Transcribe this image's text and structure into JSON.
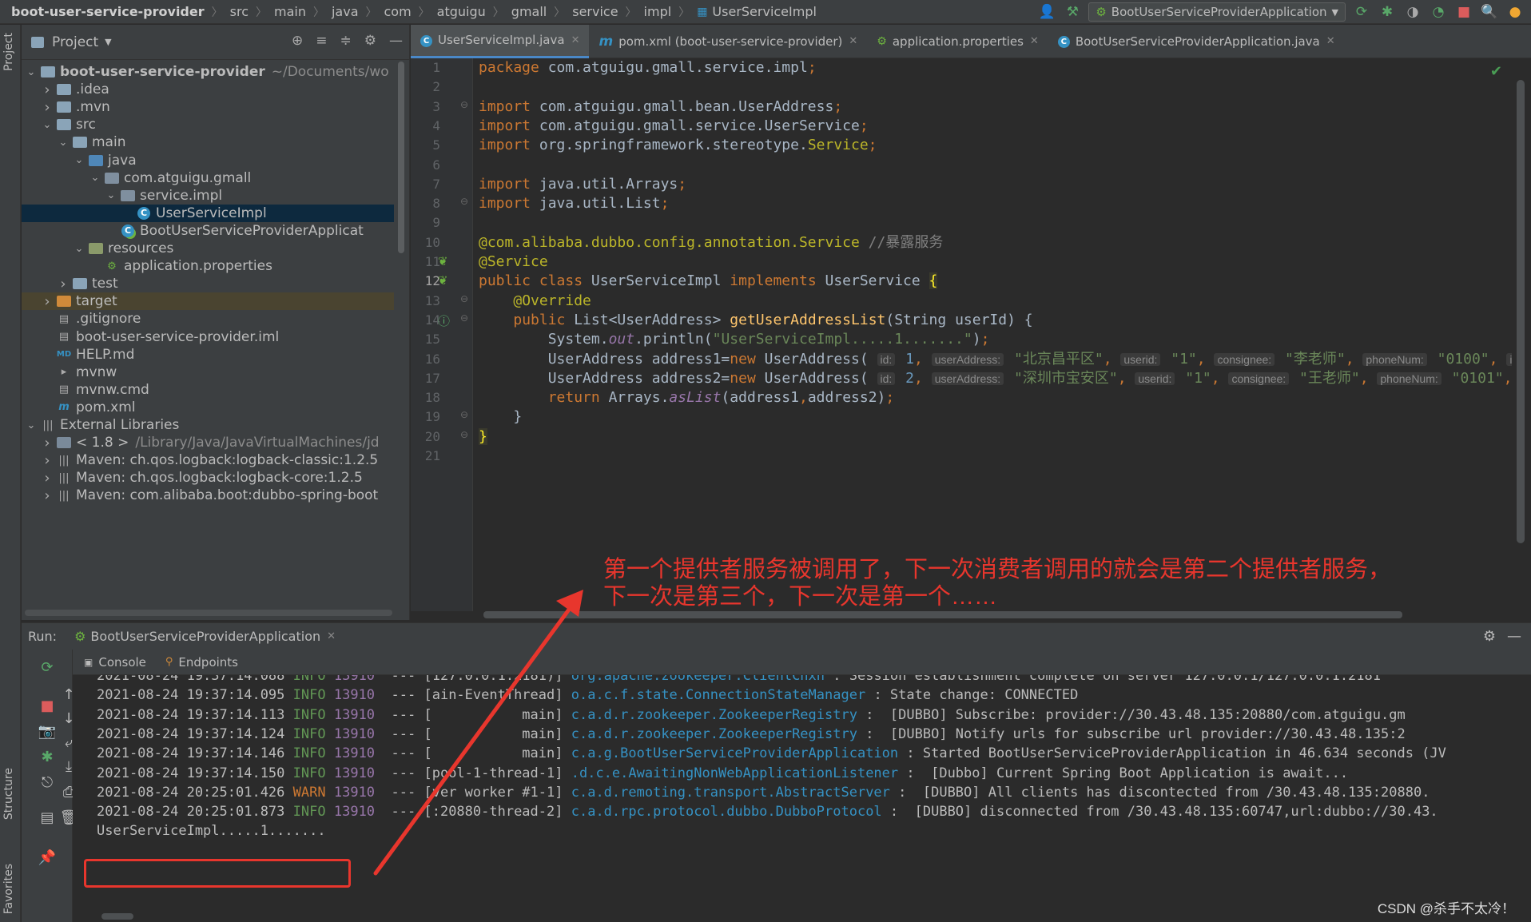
{
  "breadcrumbs": [
    "boot-user-service-provider",
    "src",
    "main",
    "java",
    "com",
    "atguigu",
    "gmall",
    "service",
    "impl",
    "UserServiceImpl"
  ],
  "run_config": "BootUserServiceProviderApplication",
  "left_stripe": {
    "project": "Project",
    "structure": "Structure",
    "favorites": "Favorites"
  },
  "project_panel": {
    "title": "Project",
    "tree": [
      {
        "label": "boot-user-service-provider",
        "extra": "~/Documents/wo",
        "depth": 0,
        "arrow": "down",
        "icon": "module-folder-icon",
        "bold": true
      },
      {
        "label": ".idea",
        "depth": 1,
        "arrow": "right",
        "icon": "folder-icon"
      },
      {
        "label": ".mvn",
        "depth": 1,
        "arrow": "right",
        "icon": "folder-icon"
      },
      {
        "label": "src",
        "depth": 1,
        "arrow": "down",
        "icon": "folder-icon"
      },
      {
        "label": "main",
        "depth": 2,
        "arrow": "down",
        "icon": "folder-icon"
      },
      {
        "label": "java",
        "depth": 3,
        "arrow": "down",
        "icon": "source-folder-icon"
      },
      {
        "label": "com.atguigu.gmall",
        "depth": 4,
        "arrow": "down",
        "icon": "package-icon"
      },
      {
        "label": "service.impl",
        "depth": 5,
        "arrow": "down",
        "icon": "package-icon"
      },
      {
        "label": "UserServiceImpl",
        "depth": 6,
        "arrow": "none",
        "icon": "class-icon",
        "selected": true
      },
      {
        "label": "BootUserServiceProviderApplicat",
        "depth": 5,
        "arrow": "none",
        "icon": "spring-class-icon"
      },
      {
        "label": "resources",
        "depth": 3,
        "arrow": "down",
        "icon": "resources-folder-icon"
      },
      {
        "label": "application.properties",
        "depth": 4,
        "arrow": "none",
        "icon": "properties-file-icon"
      },
      {
        "label": "test",
        "depth": 2,
        "arrow": "right",
        "icon": "folder-icon"
      },
      {
        "label": "target",
        "depth": 1,
        "arrow": "right",
        "icon": "excluded-folder-icon",
        "target": true
      },
      {
        "label": ".gitignore",
        "depth": 1,
        "arrow": "none",
        "icon": "file-icon"
      },
      {
        "label": "boot-user-service-provider.iml",
        "depth": 1,
        "arrow": "none",
        "icon": "iml-file-icon"
      },
      {
        "label": "HELP.md",
        "depth": 1,
        "arrow": "none",
        "icon": "markdown-file-icon"
      },
      {
        "label": "mvnw",
        "depth": 1,
        "arrow": "none",
        "icon": "script-file-icon"
      },
      {
        "label": "mvnw.cmd",
        "depth": 1,
        "arrow": "none",
        "icon": "file-icon"
      },
      {
        "label": "pom.xml",
        "depth": 1,
        "arrow": "none",
        "icon": "maven-icon"
      },
      {
        "label": "External Libraries",
        "depth": 0,
        "arrow": "down",
        "icon": "library-icon"
      },
      {
        "label": "< 1.8 >",
        "extra": "/Library/Java/JavaVirtualMachines/jd",
        "depth": 1,
        "arrow": "right",
        "icon": "jdk-icon"
      },
      {
        "label": "Maven: ch.qos.logback:logback-classic:1.2.5",
        "depth": 1,
        "arrow": "right",
        "icon": "library-icon"
      },
      {
        "label": "Maven: ch.qos.logback:logback-core:1.2.5",
        "depth": 1,
        "arrow": "right",
        "icon": "library-icon"
      },
      {
        "label": "Maven: com.alibaba.boot:dubbo-spring-boot",
        "depth": 1,
        "arrow": "right",
        "icon": "library-icon"
      }
    ]
  },
  "editor_tabs": [
    {
      "label": "UserServiceImpl.java",
      "icon": "class-icon",
      "active": true
    },
    {
      "label": "pom.xml (boot-user-service-provider)",
      "icon": "maven-icon"
    },
    {
      "label": "application.properties",
      "icon": "properties-file-icon"
    },
    {
      "label": "BootUserServiceProviderApplication.java",
      "icon": "spring-class-icon"
    }
  ],
  "editor": {
    "current_line": 12,
    "lines": [
      [
        {
          "t": "package ",
          "c": "kw"
        },
        {
          "t": "com.atguigu.gmall.service.impl",
          "c": ""
        },
        {
          "t": ";",
          "c": "kw"
        }
      ],
      [],
      [
        {
          "t": "import ",
          "c": "kw"
        },
        {
          "t": "com.atguigu.gmall.bean.UserAddress",
          "c": ""
        },
        {
          "t": ";",
          "c": "kw"
        }
      ],
      [
        {
          "t": "import ",
          "c": "kw"
        },
        {
          "t": "com.atguigu.gmall.service.UserService",
          "c": ""
        },
        {
          "t": ";",
          "c": "kw"
        }
      ],
      [
        {
          "t": "import ",
          "c": "kw"
        },
        {
          "t": "org.springframework.stereotype.",
          "c": ""
        },
        {
          "t": "Service",
          "c": "ann"
        },
        {
          "t": ";",
          "c": "kw"
        }
      ],
      [],
      [
        {
          "t": "import ",
          "c": "kw"
        },
        {
          "t": "java.util.Arrays",
          "c": ""
        },
        {
          "t": ";",
          "c": "kw"
        }
      ],
      [
        {
          "t": "import ",
          "c": "kw"
        },
        {
          "t": "java.util.List",
          "c": ""
        },
        {
          "t": ";",
          "c": "kw"
        }
      ],
      [],
      [
        {
          "t": "@com.alibaba.dubbo.config.annotation.",
          "c": "ann"
        },
        {
          "t": "Service ",
          "c": "ann"
        },
        {
          "t": "//暴露服务",
          "c": "cm"
        }
      ],
      [
        {
          "t": "@Service",
          "c": "ann"
        }
      ],
      [
        {
          "t": "public class ",
          "c": "kw"
        },
        {
          "t": "UserServiceImpl ",
          "c": ""
        },
        {
          "t": "implements ",
          "c": "kw"
        },
        {
          "t": "UserService ",
          "c": ""
        },
        {
          "t": "{",
          "c": "hl"
        }
      ],
      [
        {
          "t": "    ",
          "c": ""
        },
        {
          "t": "@Override",
          "c": "ann"
        }
      ],
      [
        {
          "t": "    ",
          "c": ""
        },
        {
          "t": "public ",
          "c": "kw"
        },
        {
          "t": "List<UserAddress> ",
          "c": ""
        },
        {
          "t": "getUserAddressList",
          "c": "fn"
        },
        {
          "t": "(String userId) {",
          "c": ""
        }
      ],
      [
        {
          "t": "        System.",
          "c": ""
        },
        {
          "t": "out",
          "c": "stat"
        },
        {
          "t": ".println(",
          "c": ""
        },
        {
          "t": "\"UserServiceImpl.....1.......\"",
          "c": "str"
        },
        {
          "t": ")",
          "c": ""
        },
        {
          "t": ";",
          "c": "kw"
        }
      ],
      [
        {
          "t": "        UserAddress address1=",
          "c": ""
        },
        {
          "t": "new ",
          "c": "kw"
        },
        {
          "t": "UserAddress( ",
          "c": ""
        },
        {
          "t": "id:",
          "c": "hint"
        },
        {
          "t": " 1",
          "c": "num"
        },
        {
          "t": ", ",
          "c": "kw"
        },
        {
          "t": "userAddress:",
          "c": "hint"
        },
        {
          "t": " \"北京昌平区\"",
          "c": "str"
        },
        {
          "t": ", ",
          "c": "kw"
        },
        {
          "t": "userid:",
          "c": "hint"
        },
        {
          "t": " \"1\"",
          "c": "str"
        },
        {
          "t": ", ",
          "c": "kw"
        },
        {
          "t": "consignee:",
          "c": "hint"
        },
        {
          "t": " \"李老师\"",
          "c": "str"
        },
        {
          "t": ", ",
          "c": "kw"
        },
        {
          "t": "phoneNum:",
          "c": "hint"
        },
        {
          "t": " \"0100\"",
          "c": "str"
        },
        {
          "t": ", ",
          "c": "kw"
        },
        {
          "t": "isD",
          "c": "hint"
        }
      ],
      [
        {
          "t": "        UserAddress address2=",
          "c": ""
        },
        {
          "t": "new ",
          "c": "kw"
        },
        {
          "t": "UserAddress( ",
          "c": ""
        },
        {
          "t": "id:",
          "c": "hint"
        },
        {
          "t": " 2",
          "c": "num"
        },
        {
          "t": ", ",
          "c": "kw"
        },
        {
          "t": "userAddress:",
          "c": "hint"
        },
        {
          "t": " \"深圳市宝安区\"",
          "c": "str"
        },
        {
          "t": ", ",
          "c": "kw"
        },
        {
          "t": "userid:",
          "c": "hint"
        },
        {
          "t": " \"1\"",
          "c": "str"
        },
        {
          "t": ", ",
          "c": "kw"
        },
        {
          "t": "consignee:",
          "c": "hint"
        },
        {
          "t": " \"王老师\"",
          "c": "str"
        },
        {
          "t": ", ",
          "c": "kw"
        },
        {
          "t": "phoneNum:",
          "c": "hint"
        },
        {
          "t": " \"0101\"",
          "c": "str"
        },
        {
          "t": ", ",
          "c": "kw"
        },
        {
          "t": "i",
          "c": "hint"
        }
      ],
      [
        {
          "t": "        ",
          "c": ""
        },
        {
          "t": "return ",
          "c": "kw"
        },
        {
          "t": "Arrays.",
          "c": ""
        },
        {
          "t": "asList",
          "c": "stat"
        },
        {
          "t": "(address1",
          "c": ""
        },
        {
          "t": ",",
          "c": "kw"
        },
        {
          "t": "address2)",
          "c": ""
        },
        {
          "t": ";",
          "c": "kw"
        }
      ],
      [
        {
          "t": "    }",
          "c": ""
        }
      ],
      [
        {
          "t": "}",
          "c": "hl"
        }
      ],
      []
    ]
  },
  "annotation": {
    "line1": "第一个提供者服务被调用了，下一次消费者调用的就会是第二个提供者服务，",
    "line2": "下一次是第三个，下一次是第一个……"
  },
  "run_panel": {
    "label": "Run:",
    "tab": "BootUserServiceProviderApplication",
    "subtabs": [
      "Console",
      "Endpoints"
    ]
  },
  "console": {
    "lines": [
      {
        "ts": "2021-08-24 19:37:14.088",
        "level": "INFO",
        "pid": "13910",
        "thread": "[127.0.0.1:2181)]",
        "logger": "org.apache.zookeeper.ClientCnxn",
        "msg": ": Session establishment complete on server 127.0.0.1/127.0.0.1:2181"
      },
      {
        "ts": "2021-08-24 19:37:14.095",
        "level": "INFO",
        "pid": "13910",
        "thread": "[ain-EventThread]",
        "logger": "o.a.c.f.state.ConnectionStateManager",
        "msg": ": State change: CONNECTED"
      },
      {
        "ts": "2021-08-24 19:37:14.113",
        "level": "INFO",
        "pid": "13910",
        "thread": "[           main]",
        "logger": "c.a.d.r.zookeeper.ZookeeperRegistry",
        "msg": ":  [DUBBO] Subscribe: provider://30.43.48.135:20880/com.atguigu.gm"
      },
      {
        "ts": "2021-08-24 19:37:14.124",
        "level": "INFO",
        "pid": "13910",
        "thread": "[           main]",
        "logger": "c.a.d.r.zookeeper.ZookeeperRegistry",
        "msg": ":  [DUBBO] Notify urls for subscribe url provider://30.43.48.135:2"
      },
      {
        "ts": "2021-08-24 19:37:14.146",
        "level": "INFO",
        "pid": "13910",
        "thread": "[           main]",
        "logger": "c.a.g.BootUserServiceProviderApplication",
        "msg": ": Started BootUserServiceProviderApplication in 46.634 seconds (JV"
      },
      {
        "ts": "2021-08-24 19:37:14.150",
        "level": "INFO",
        "pid": "13910",
        "thread": "[pool-1-thread-1]",
        "logger": ".d.c.e.AwaitingNonWebApplicationListener",
        "msg": ":  [Dubbo] Current Spring Boot Application is await..."
      },
      {
        "ts": "2021-08-24 20:25:01.426",
        "level": "WARN",
        "pid": "13910",
        "thread": "[ver worker #1-1]",
        "logger": "c.a.d.remoting.transport.AbstractServer",
        "msg": ":  [DUBBO] All clients has discontected from /30.43.48.135:20880."
      },
      {
        "ts": "2021-08-24 20:25:01.873",
        "level": "INFO",
        "pid": "13910",
        "thread": "[:20880-thread-2]",
        "logger": "c.a.d.rpc.protocol.dubbo.DubboProtocol",
        "msg": ":  [DUBBO] disconnected from /30.43.48.135:60747,url:dubbo://30.43."
      }
    ],
    "output": "UserServiceImpl.....1......."
  },
  "footer": "CSDN @杀手不太冷！",
  "colors": {
    "accent": "#4a88c7",
    "annotation_red": "#e8362d",
    "keyword": "#cc7832",
    "string": "#6a8759",
    "annotation": "#bbb529"
  }
}
